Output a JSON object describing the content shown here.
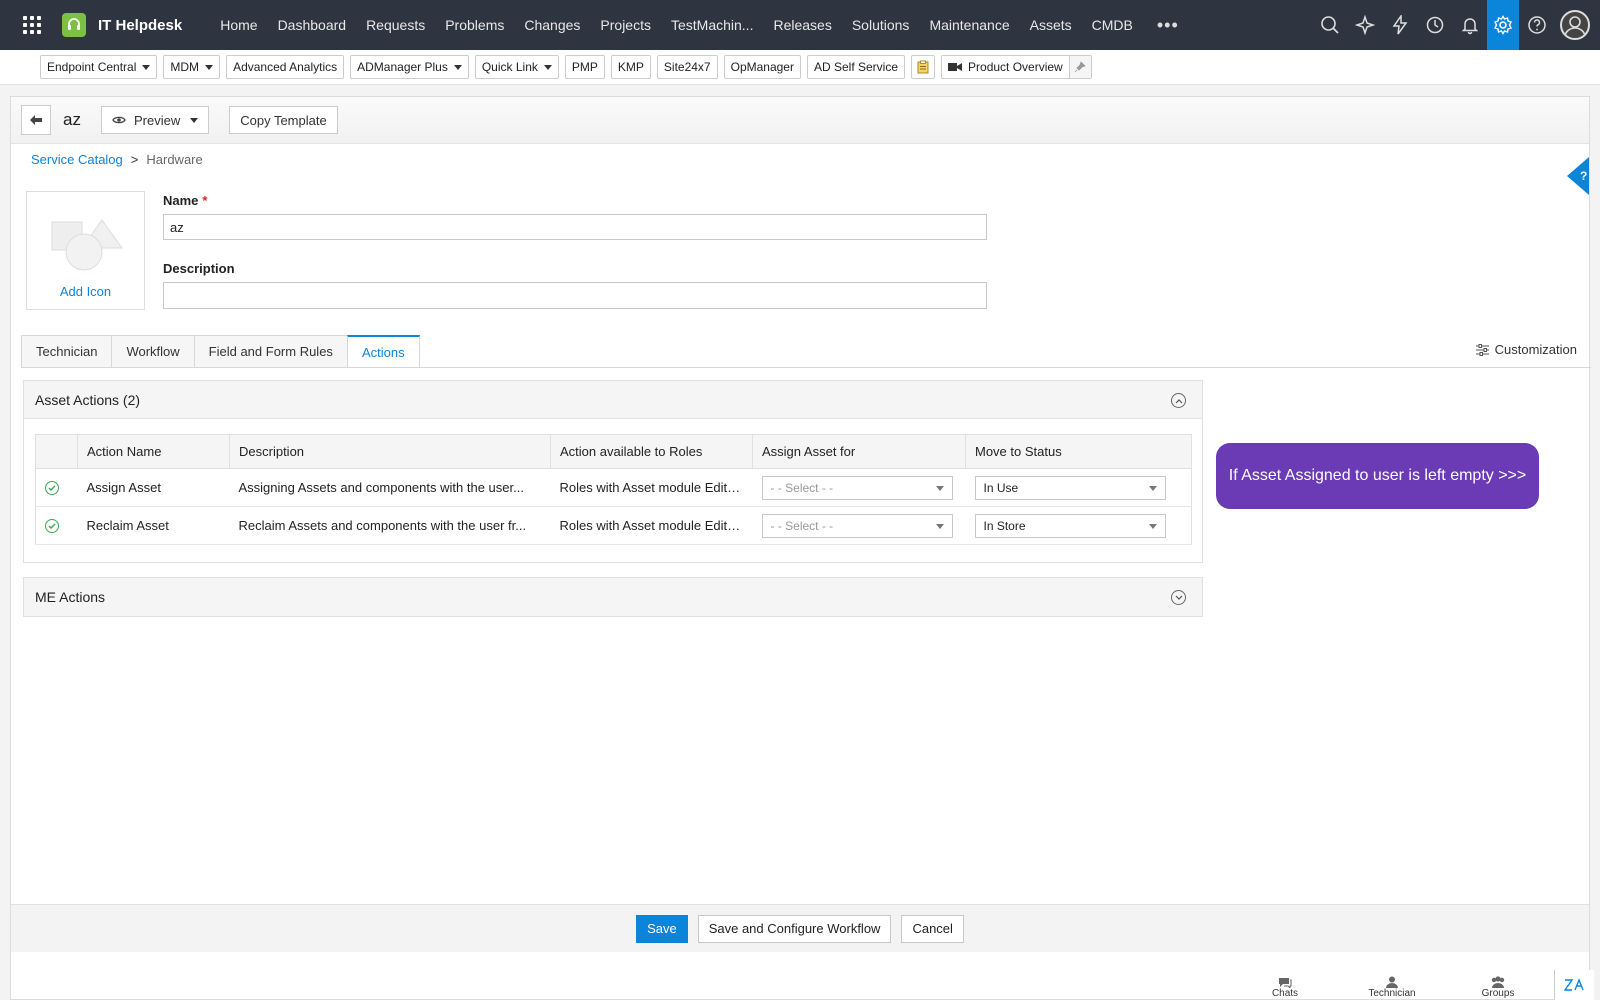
{
  "topnav": {
    "app_title": "IT Helpdesk",
    "items": [
      "Home",
      "Dashboard",
      "Requests",
      "Problems",
      "Changes",
      "Projects",
      "TestMachin...",
      "Releases",
      "Solutions",
      "Maintenance",
      "Assets",
      "CMDB"
    ],
    "more": "•••",
    "icons": [
      "search-icon",
      "zia-icon",
      "flash-icon",
      "history-icon",
      "bell-icon",
      "settings-icon",
      "help-icon",
      "user-avatar"
    ]
  },
  "quicklinks": {
    "endpoint": "Endpoint Central",
    "mdm": "MDM",
    "analytics": "Advanced Analytics",
    "admanager": "ADManager Plus",
    "quicklink": "Quick Link",
    "pmp": "PMP",
    "kmp": "KMP",
    "site24x7": "Site24x7",
    "opmanager": "OpManager",
    "adself": "AD Self Service",
    "product_overview": "Product Overview"
  },
  "header": {
    "template_name": "az",
    "preview_label": "Preview",
    "copy_label": "Copy Template"
  },
  "breadcrumb": {
    "root": "Service Catalog",
    "separator": ">",
    "current": "Hardware"
  },
  "icon_box": {
    "add_label": "Add Icon"
  },
  "form": {
    "name_label": "Name",
    "required_mark": "*",
    "name_value": "az",
    "description_label": "Description",
    "description_value": ""
  },
  "tabs": {
    "technician": "Technician",
    "workflow": "Workflow",
    "rules": "Field and Form Rules",
    "actions": "Actions",
    "active": "Actions",
    "customization": "Customization"
  },
  "asset_actions": {
    "title": "Asset Actions (2)",
    "columns": {
      "action_name": "Action Name",
      "description": "Description",
      "roles": "Action available to Roles",
      "assign_for": "Assign Asset for",
      "move_status": "Move to Status"
    },
    "rows": [
      {
        "name": "Assign Asset",
        "description": "Assigning Assets and components with the user...",
        "roles": "Roles with Asset module Edit P...",
        "assign_for": "- - Select - -",
        "status": "In Use"
      },
      {
        "name": "Reclaim Asset",
        "description": "Reclaim Assets and components with the user fr...",
        "roles": "Roles with Asset module Edit P...",
        "assign_for": "- - Select - -",
        "status": "In Store"
      }
    ]
  },
  "me_actions": {
    "title": "ME Actions"
  },
  "tooltip": {
    "text": "If Asset Assigned to user is left empty >>>"
  },
  "footer": {
    "save": "Save",
    "save_configure": "Save and Configure Workflow",
    "cancel": "Cancel"
  },
  "bottombar": {
    "chats": "Chats",
    "technician": "Technician",
    "groups": "Groups"
  },
  "colors": {
    "topnav_bg": "#2e3440",
    "accent": "#0a85d9",
    "bubble": "#6a3bb5",
    "logo_green": "#7cc142",
    "check_green": "#3aa655",
    "required": "#e02020"
  }
}
